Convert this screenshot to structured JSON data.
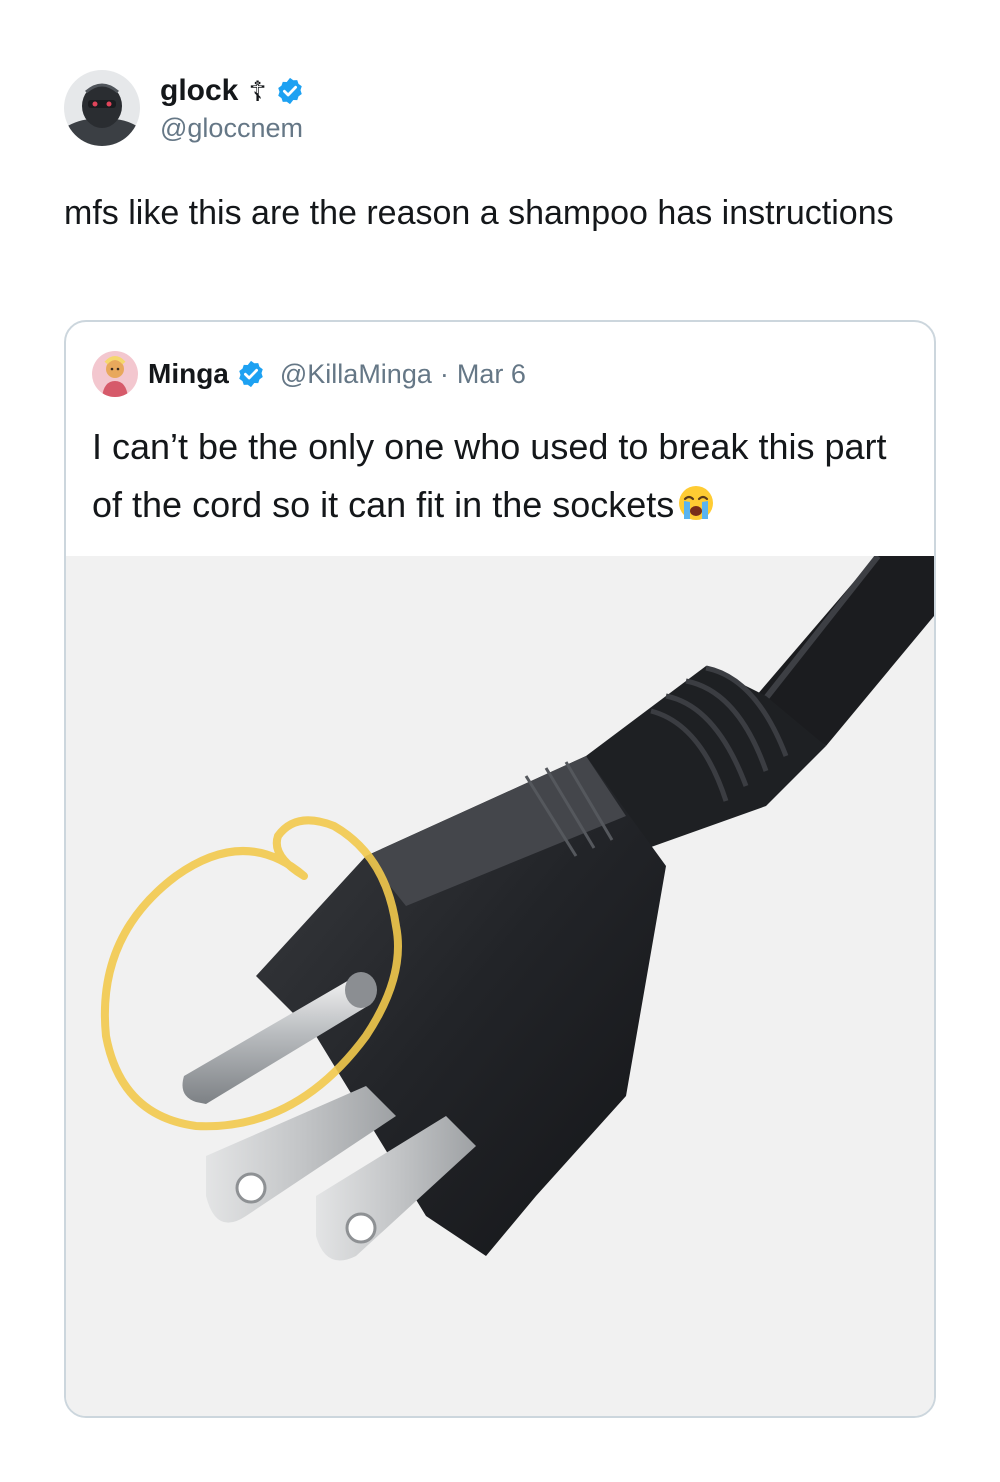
{
  "tweet": {
    "author": {
      "display_name": "glock",
      "name_symbol": "☦",
      "handle": "@gloccnem",
      "verified": true,
      "avatar_icon": "robot-avatar-icon"
    },
    "text": "mfs like this are the reason a shampoo has instructions"
  },
  "quoted_tweet": {
    "author": {
      "display_name": "Minga",
      "handle": "@KillaMinga",
      "verified": true,
      "avatar_icon": "cartoon-avatar-icon"
    },
    "separator": "·",
    "date": "Mar 6",
    "text": "I can’t be the only one who used to break this part of the cord so it can fit in the sockets",
    "emoji": "loudly-crying-face-icon",
    "media": {
      "subject": "three-prong-plug-photo",
      "highlight": "yellow-circle-annotation"
    }
  },
  "colors": {
    "text_primary": "#14171a",
    "text_secondary": "#657786",
    "verified_blue": "#1da1f2",
    "border": "#ccd6dd",
    "highlight_yellow": "#f2c94c"
  }
}
